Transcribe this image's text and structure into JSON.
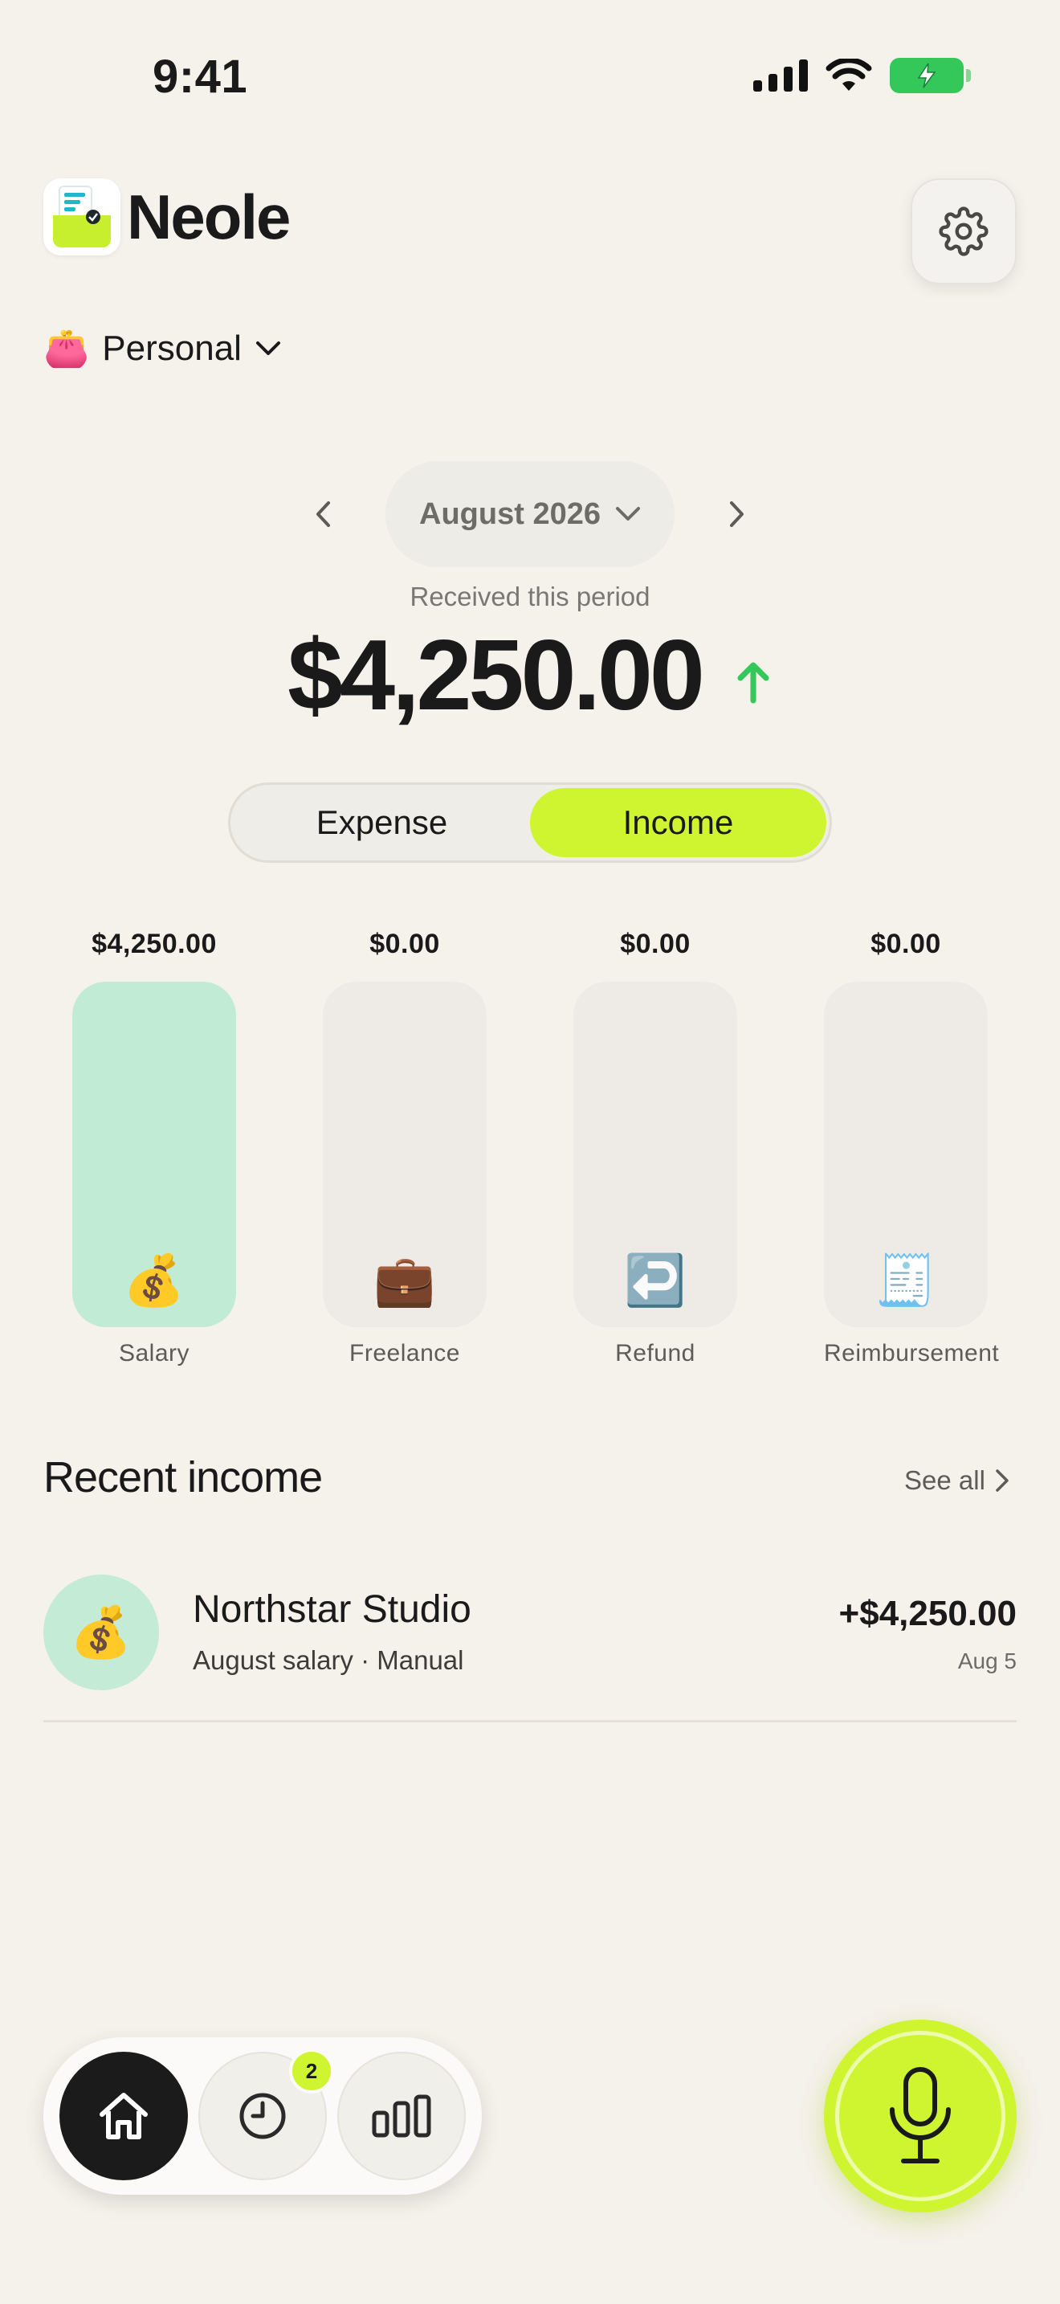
{
  "status_bar": {
    "time": "9:41"
  },
  "header": {
    "app_name": "Neole",
    "settings_icon": "gear-icon"
  },
  "account": {
    "emoji": "👛",
    "label": "Personal"
  },
  "period": {
    "label": "August 2026",
    "caption": "Received this period",
    "total": "$4,250.00",
    "trend": "up",
    "trend_color": "#34C759"
  },
  "segmented": {
    "expense_label": "Expense",
    "income_label": "Income",
    "selected": "Income",
    "accent": "#CFF531"
  },
  "categories": [
    {
      "value": "$4,250.00",
      "label": "Salary",
      "emoji": "💰",
      "fill_fraction": 1.0,
      "fill_color": "#C2EBD5"
    },
    {
      "value": "$0.00",
      "label": "Freelance",
      "emoji": "💼",
      "fill_fraction": 0,
      "fill_color": "#C2EBD5"
    },
    {
      "value": "$0.00",
      "label": "Refund",
      "emoji": "↩️",
      "fill_fraction": 0,
      "fill_color": "#C2EBD5"
    },
    {
      "value": "$0.00",
      "label": "Reimbursement",
      "emoji": "🧾",
      "fill_fraction": 0,
      "fill_color": "#C2EBD5"
    }
  ],
  "recent": {
    "title": "Recent income",
    "see_all": "See all",
    "items": [
      {
        "emoji": "💰",
        "name": "Northstar Studio",
        "subtitle": "August salary · Manual",
        "amount": "+$4,250.00",
        "date": "Aug 5"
      }
    ]
  },
  "tabbar": {
    "badge_count": "2",
    "tabs": [
      "home-icon",
      "clock-icon",
      "bar-chart-icon"
    ]
  },
  "mic": {
    "icon": "microphone-icon"
  }
}
